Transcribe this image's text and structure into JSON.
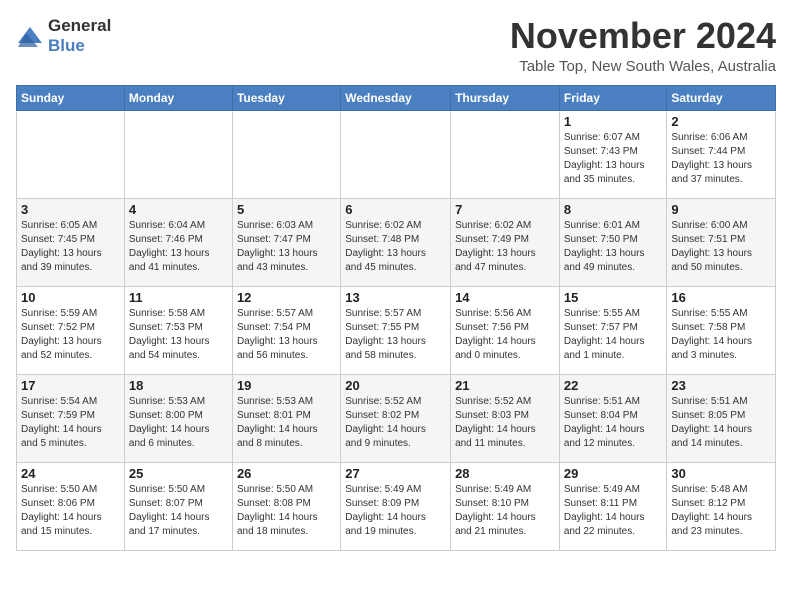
{
  "header": {
    "logo_general": "General",
    "logo_blue": "Blue",
    "month_title": "November 2024",
    "subtitle": "Table Top, New South Wales, Australia"
  },
  "days_of_week": [
    "Sunday",
    "Monday",
    "Tuesday",
    "Wednesday",
    "Thursday",
    "Friday",
    "Saturday"
  ],
  "weeks": [
    [
      {
        "day": "",
        "info": ""
      },
      {
        "day": "",
        "info": ""
      },
      {
        "day": "",
        "info": ""
      },
      {
        "day": "",
        "info": ""
      },
      {
        "day": "",
        "info": ""
      },
      {
        "day": "1",
        "info": "Sunrise: 6:07 AM\nSunset: 7:43 PM\nDaylight: 13 hours\nand 35 minutes."
      },
      {
        "day": "2",
        "info": "Sunrise: 6:06 AM\nSunset: 7:44 PM\nDaylight: 13 hours\nand 37 minutes."
      }
    ],
    [
      {
        "day": "3",
        "info": "Sunrise: 6:05 AM\nSunset: 7:45 PM\nDaylight: 13 hours\nand 39 minutes."
      },
      {
        "day": "4",
        "info": "Sunrise: 6:04 AM\nSunset: 7:46 PM\nDaylight: 13 hours\nand 41 minutes."
      },
      {
        "day": "5",
        "info": "Sunrise: 6:03 AM\nSunset: 7:47 PM\nDaylight: 13 hours\nand 43 minutes."
      },
      {
        "day": "6",
        "info": "Sunrise: 6:02 AM\nSunset: 7:48 PM\nDaylight: 13 hours\nand 45 minutes."
      },
      {
        "day": "7",
        "info": "Sunrise: 6:02 AM\nSunset: 7:49 PM\nDaylight: 13 hours\nand 47 minutes."
      },
      {
        "day": "8",
        "info": "Sunrise: 6:01 AM\nSunset: 7:50 PM\nDaylight: 13 hours\nand 49 minutes."
      },
      {
        "day": "9",
        "info": "Sunrise: 6:00 AM\nSunset: 7:51 PM\nDaylight: 13 hours\nand 50 minutes."
      }
    ],
    [
      {
        "day": "10",
        "info": "Sunrise: 5:59 AM\nSunset: 7:52 PM\nDaylight: 13 hours\nand 52 minutes."
      },
      {
        "day": "11",
        "info": "Sunrise: 5:58 AM\nSunset: 7:53 PM\nDaylight: 13 hours\nand 54 minutes."
      },
      {
        "day": "12",
        "info": "Sunrise: 5:57 AM\nSunset: 7:54 PM\nDaylight: 13 hours\nand 56 minutes."
      },
      {
        "day": "13",
        "info": "Sunrise: 5:57 AM\nSunset: 7:55 PM\nDaylight: 13 hours\nand 58 minutes."
      },
      {
        "day": "14",
        "info": "Sunrise: 5:56 AM\nSunset: 7:56 PM\nDaylight: 14 hours\nand 0 minutes."
      },
      {
        "day": "15",
        "info": "Sunrise: 5:55 AM\nSunset: 7:57 PM\nDaylight: 14 hours\nand 1 minute."
      },
      {
        "day": "16",
        "info": "Sunrise: 5:55 AM\nSunset: 7:58 PM\nDaylight: 14 hours\nand 3 minutes."
      }
    ],
    [
      {
        "day": "17",
        "info": "Sunrise: 5:54 AM\nSunset: 7:59 PM\nDaylight: 14 hours\nand 5 minutes."
      },
      {
        "day": "18",
        "info": "Sunrise: 5:53 AM\nSunset: 8:00 PM\nDaylight: 14 hours\nand 6 minutes."
      },
      {
        "day": "19",
        "info": "Sunrise: 5:53 AM\nSunset: 8:01 PM\nDaylight: 14 hours\nand 8 minutes."
      },
      {
        "day": "20",
        "info": "Sunrise: 5:52 AM\nSunset: 8:02 PM\nDaylight: 14 hours\nand 9 minutes."
      },
      {
        "day": "21",
        "info": "Sunrise: 5:52 AM\nSunset: 8:03 PM\nDaylight: 14 hours\nand 11 minutes."
      },
      {
        "day": "22",
        "info": "Sunrise: 5:51 AM\nSunset: 8:04 PM\nDaylight: 14 hours\nand 12 minutes."
      },
      {
        "day": "23",
        "info": "Sunrise: 5:51 AM\nSunset: 8:05 PM\nDaylight: 14 hours\nand 14 minutes."
      }
    ],
    [
      {
        "day": "24",
        "info": "Sunrise: 5:50 AM\nSunset: 8:06 PM\nDaylight: 14 hours\nand 15 minutes."
      },
      {
        "day": "25",
        "info": "Sunrise: 5:50 AM\nSunset: 8:07 PM\nDaylight: 14 hours\nand 17 minutes."
      },
      {
        "day": "26",
        "info": "Sunrise: 5:50 AM\nSunset: 8:08 PM\nDaylight: 14 hours\nand 18 minutes."
      },
      {
        "day": "27",
        "info": "Sunrise: 5:49 AM\nSunset: 8:09 PM\nDaylight: 14 hours\nand 19 minutes."
      },
      {
        "day": "28",
        "info": "Sunrise: 5:49 AM\nSunset: 8:10 PM\nDaylight: 14 hours\nand 21 minutes."
      },
      {
        "day": "29",
        "info": "Sunrise: 5:49 AM\nSunset: 8:11 PM\nDaylight: 14 hours\nand 22 minutes."
      },
      {
        "day": "30",
        "info": "Sunrise: 5:48 AM\nSunset: 8:12 PM\nDaylight: 14 hours\nand 23 minutes."
      }
    ]
  ]
}
